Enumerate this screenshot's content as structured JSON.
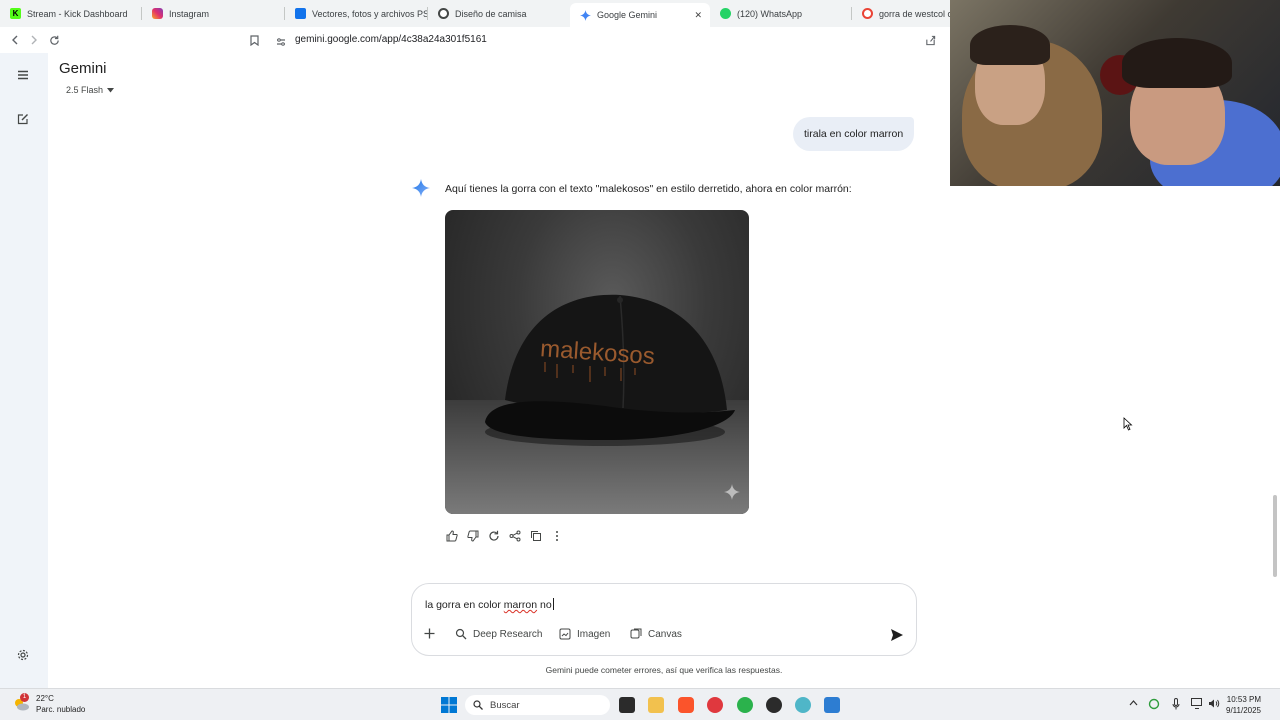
{
  "tabs": [
    {
      "label": "Stream - Kick Dashboard",
      "icon": "kick-icon",
      "color": "#53fc18"
    },
    {
      "label": "Instagram",
      "icon": "instagram-icon",
      "color": "#e1306c"
    },
    {
      "label": "Vectores, fotos y archivos PSD",
      "icon": "freepik-icon",
      "color": "#1273eb"
    },
    {
      "label": "Diseño de camisa",
      "icon": "web-icon",
      "color": "#444746"
    },
    {
      "label": "Google Gemini",
      "icon": "gemini-icon",
      "color": "#4285f4",
      "active": true
    },
    {
      "label": "(120) WhatsApp",
      "icon": "whatsapp-icon",
      "color": "#25d366"
    },
    {
      "label": "gorra de westcol or",
      "icon": "google-search-icon",
      "color": "#ea4335"
    }
  ],
  "browser": {
    "url": "gemini.google.com/app/4c38a24a301f5161"
  },
  "app": {
    "title": "Gemini",
    "model": "2.5 Flash"
  },
  "chat": {
    "user_message": "tirala en color marron",
    "assistant_text": "Aquí tienes la gorra con el texto \"malekosos\" en estilo derretido, ahora en color marrón:",
    "image_caption_text": "malekosos"
  },
  "composer": {
    "text_before": "la gorra en color ",
    "text_misspelled": "marron",
    "text_after": " no",
    "tools": [
      {
        "label": "Deep Research",
        "icon": "deep-research-icon"
      },
      {
        "label": "Imagen",
        "icon": "image-icon"
      },
      {
        "label": "Canvas",
        "icon": "canvas-icon"
      }
    ]
  },
  "disclaimer": "Gemini puede cometer errores, así que verifica las respuestas.",
  "taskbar": {
    "weather_temp": "22°C",
    "weather_desc": "Parc. nublado",
    "weather_badge": "1",
    "search_placeholder": "Buscar",
    "time": "10:53 PM",
    "date": "9/11/2025"
  }
}
